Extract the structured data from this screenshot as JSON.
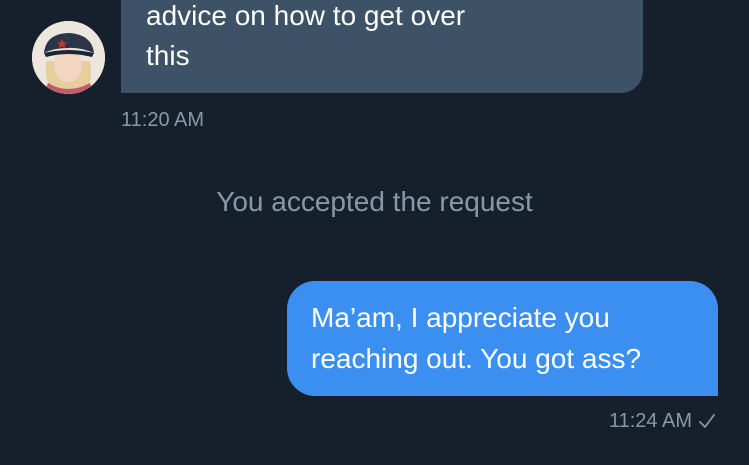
{
  "conversation": {
    "incoming": {
      "lines": [
        "advice on how to get over",
        "this"
      ],
      "timestamp": "11:20 AM",
      "colors": {
        "bubble": "#3d5266",
        "text": "#ffffff"
      }
    },
    "system_message": "You accepted the request",
    "outgoing": {
      "lines": [
        "Ma’am, I appreciate you",
        "reaching out. You got ass?"
      ],
      "timestamp": "11:24 AM",
      "status_icon": "check-icon",
      "colors": {
        "bubble": "#3b8ff0",
        "text": "#ffffff"
      }
    }
  },
  "theme": {
    "background": "#16202c",
    "muted_text": "#8899a6"
  }
}
